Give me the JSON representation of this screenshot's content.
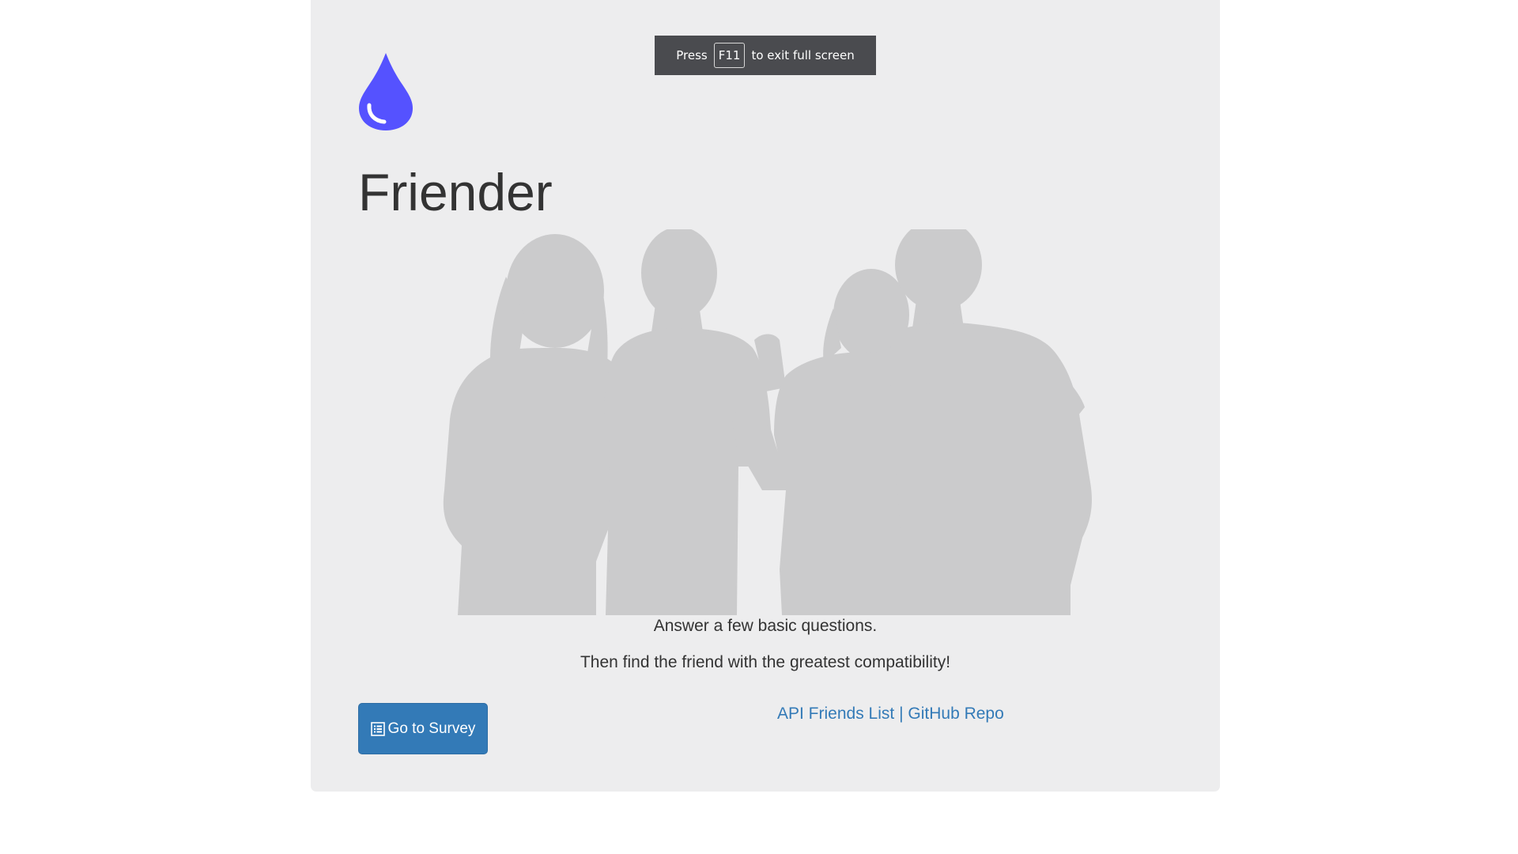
{
  "fullscreen_notice": {
    "before": "Press",
    "key": "F11",
    "after": "to exit full screen"
  },
  "brand": {
    "logo_icon": "water-drop-icon",
    "logo_color": "#5552ff",
    "title": "Friender"
  },
  "hero": {
    "image": "group-of-friends-silhouette"
  },
  "tagline": {
    "line1": "Answer a few basic questions.",
    "line2": "Then find the friend with the greatest compatibility!"
  },
  "actions": {
    "survey_icon": "list-alt-icon",
    "survey_label": "Go to Survey",
    "api_link": "API Friends List",
    "separator": "|",
    "github_link": "GitHub Repo"
  },
  "colors": {
    "accent": "#337ab7",
    "panel": "#ededee",
    "silhouette": "#cbcbcc"
  }
}
